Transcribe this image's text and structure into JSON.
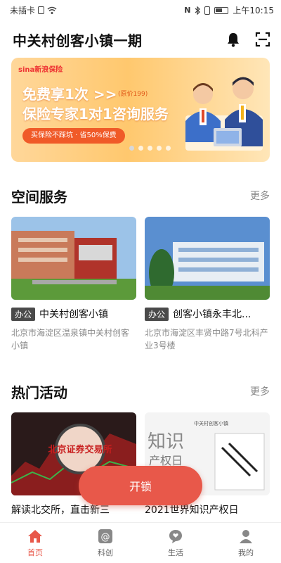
{
  "status_bar": {
    "carrier": "未插卡",
    "time": "上午10:15",
    "icons": [
      "sim-icon",
      "wifi-icon",
      "nfc-icon",
      "bluetooth-icon",
      "vibrate-icon",
      "battery-icon"
    ]
  },
  "header": {
    "title": "中关村创客小镇一期",
    "icons": [
      "bell-icon",
      "scan-icon"
    ]
  },
  "banner": {
    "brand": "sina新浪保险",
    "line1": "免费享1次 >>",
    "original_price": "(原价199)",
    "line2": "保险专家1对1咨询服务",
    "pill": "买保险不踩坑 · 省50%保费",
    "dots": 5,
    "active_dot": 0
  },
  "space_section": {
    "title": "空间服务",
    "more": "更多",
    "cards": [
      {
        "tag": "办公",
        "title": "中关村创客小镇",
        "address": "北京市海淀区温泉镇中关村创客小镇"
      },
      {
        "tag": "办公",
        "title": "创客小镇永丰北...",
        "address": "北京市海淀区丰贤中路7号北科产业3号楼"
      }
    ]
  },
  "activity_section": {
    "title": "热门活动",
    "more": "更多",
    "cards": [
      {
        "title": "解读北交所，直击新三",
        "image_text": "北京证券交易所"
      },
      {
        "title": "2021世界知识产权日",
        "image_text_1": "知识",
        "image_text_2": "产权日",
        "image_logo": "中关村创客小镇"
      }
    ]
  },
  "unlock_button": "开锁",
  "tabbar": {
    "tabs": [
      {
        "label": "首页",
        "icon": "home-icon",
        "active": true
      },
      {
        "label": "科创",
        "icon": "at-icon",
        "active": false
      },
      {
        "label": "生活",
        "icon": "chat-heart-icon",
        "active": false
      },
      {
        "label": "我的",
        "icon": "person-icon",
        "active": false
      }
    ]
  },
  "colors": {
    "accent": "#e8584a",
    "banner_pill": "#f05a28",
    "tag_bg": "#4a4a4a"
  }
}
